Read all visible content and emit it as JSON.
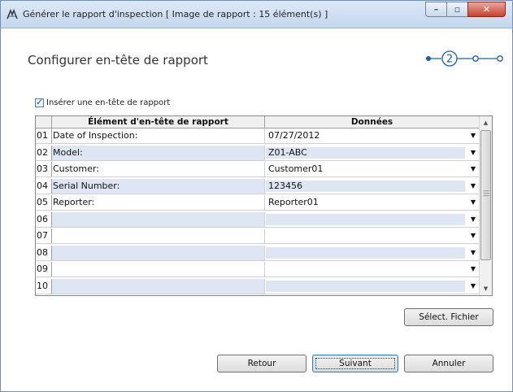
{
  "window": {
    "title": "Générer le rapport d'inspection  [ Image de rapport : 15 élément(s) ]"
  },
  "page": {
    "heading": "Configurer en-tête de rapport",
    "current_step": "2"
  },
  "checkbox": {
    "label": "Insérer une en-tête de rapport",
    "checked": true
  },
  "grid": {
    "headers": {
      "item": "Élément d'en-tête de rapport",
      "value": "Données"
    },
    "rows": [
      {
        "num": "01",
        "item": "Date of Inspection:",
        "value": "07/27/2012"
      },
      {
        "num": "02",
        "item": "Model:",
        "value": "Z01-ABC"
      },
      {
        "num": "03",
        "item": "Customer:",
        "value": "Customer01"
      },
      {
        "num": "04",
        "item": "Serial Number:",
        "value": "123456"
      },
      {
        "num": "05",
        "item": "Reporter:",
        "value": "Reporter01"
      },
      {
        "num": "06",
        "item": "",
        "value": ""
      },
      {
        "num": "07",
        "item": "",
        "value": ""
      },
      {
        "num": "08",
        "item": "",
        "value": ""
      },
      {
        "num": "09",
        "item": "",
        "value": ""
      },
      {
        "num": "10",
        "item": "",
        "value": ""
      }
    ]
  },
  "buttons": {
    "select_file": "Sélect. Fichier",
    "back": "Retour",
    "next": "Suivant",
    "cancel": "Annuler"
  },
  "colors": {
    "accent": "#1f5fa8",
    "row_alt": "#dde6f2"
  }
}
